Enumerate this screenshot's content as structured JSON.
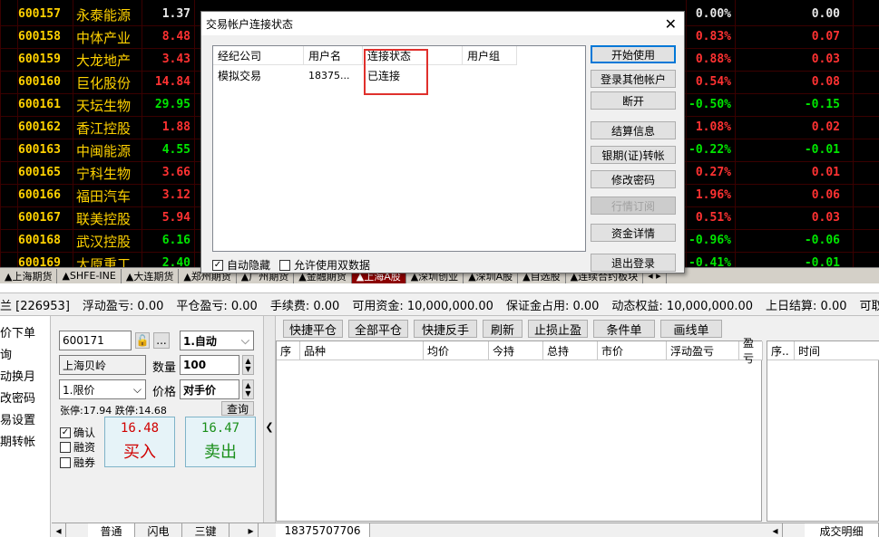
{
  "quotes": [
    {
      "code": "600157",
      "name": "永泰能源",
      "price": "1.37",
      "price_color": "white",
      "pct": "0.00%",
      "pct_color": "white",
      "chg": "0.00",
      "chg_color": "white"
    },
    {
      "code": "600158",
      "name": "中体产业",
      "price": "8.48",
      "price_color": "red",
      "pct": "0.83%",
      "pct_color": "red",
      "chg": "0.07",
      "chg_color": "red"
    },
    {
      "code": "600159",
      "name": "大龙地产",
      "price": "3.43",
      "price_color": "red",
      "pct": "0.88%",
      "pct_color": "red",
      "chg": "0.03",
      "chg_color": "red"
    },
    {
      "code": "600160",
      "name": "巨化股份",
      "price": "14.84",
      "price_color": "red",
      "pct": "0.54%",
      "pct_color": "red",
      "chg": "0.08",
      "chg_color": "red"
    },
    {
      "code": "600161",
      "name": "天坛生物",
      "price": "29.95",
      "price_color": "green",
      "pct": "-0.50%",
      "pct_color": "green",
      "chg": "-0.15",
      "chg_color": "green"
    },
    {
      "code": "600162",
      "name": "香江控股",
      "price": "1.88",
      "price_color": "red",
      "pct": "1.08%",
      "pct_color": "red",
      "chg": "0.02",
      "chg_color": "red"
    },
    {
      "code": "600163",
      "name": "中闽能源",
      "price": "4.55",
      "price_color": "green",
      "pct": "-0.22%",
      "pct_color": "green",
      "chg": "-0.01",
      "chg_color": "green"
    },
    {
      "code": "600165",
      "name": "宁科生物",
      "price": "3.66",
      "price_color": "red",
      "pct": "0.27%",
      "pct_color": "red",
      "chg": "0.01",
      "chg_color": "red"
    },
    {
      "code": "600166",
      "name": "福田汽车",
      "price": "3.12",
      "price_color": "red",
      "pct": "1.96%",
      "pct_color": "red",
      "chg": "0.06",
      "chg_color": "red"
    },
    {
      "code": "600167",
      "name": "联美控股",
      "price": "5.94",
      "price_color": "red",
      "pct": "0.51%",
      "pct_color": "red",
      "chg": "0.03",
      "chg_color": "red"
    },
    {
      "code": "600168",
      "name": "武汉控股",
      "price": "6.16",
      "price_color": "green",
      "pct": "-0.96%",
      "pct_color": "green",
      "chg": "-0.06",
      "chg_color": "green"
    },
    {
      "code": "600169",
      "name": "太原重工",
      "price": "2.40",
      "price_color": "green",
      "pct": "-0.41%",
      "pct_color": "green",
      "chg": "-0.01",
      "chg_color": "green"
    }
  ],
  "market_tabs": [
    {
      "label": "▲上海期货",
      "active": false
    },
    {
      "label": "▲SHFE-INE",
      "active": false
    },
    {
      "label": "▲大连期货",
      "active": false
    },
    {
      "label": "▲郑州期货",
      "active": false
    },
    {
      "label": "▲广州期货",
      "active": false
    },
    {
      "label": "▲金融期货",
      "active": false
    },
    {
      "label": "▲上海A股",
      "active": true
    },
    {
      "label": "▲深圳创业",
      "active": false
    },
    {
      "label": "▲深圳A股",
      "active": false
    },
    {
      "label": "▲自选股",
      "active": false
    },
    {
      "label": "▲连续合约板块",
      "active": false
    }
  ],
  "status_bar": {
    "account": "兰 [226953]",
    "float_pl": "浮动盈亏: 0.00",
    "close_pl": "平仓盈亏: 0.00",
    "fee": "手续费: 0.00",
    "avail": "可用资金: 10,000,000.00",
    "margin": "保证金占用: 0.00",
    "equity": "动态权益: 10,000,000.00",
    "settle": "上日结算: 0.00",
    "withdraw": "可取资金"
  },
  "left_menu": [
    "价下单",
    "询",
    "动换月",
    "改密码",
    "易设置",
    "期转帐"
  ],
  "order": {
    "code": "600171",
    "name": "上海贝岭",
    "mode": "1.自动",
    "qty_label": "数量",
    "qty": "100",
    "price_type": "1.限价",
    "price_label": "价格",
    "price": "对手价",
    "limits": "张停:17.94 跌停:14.68",
    "query_label": "查询",
    "more_label": "...",
    "confirm_label": "确认",
    "margin_buy_label": "融资",
    "margin_sell_label": "融券",
    "buy_price": "16.48",
    "buy_label": "买入",
    "sell_price": "16.47",
    "sell_label": "卖出"
  },
  "toolbar": [
    "快捷平仓",
    "全部平仓",
    "快捷反手",
    "刷新",
    "止损止盈",
    "条件单",
    "画线单"
  ],
  "position_headers": [
    "序",
    "品种",
    "均价",
    "今持",
    "总持",
    "市价",
    "浮动盈亏",
    "盈亏"
  ],
  "right_headers": [
    "序..",
    "时间"
  ],
  "bottom_tabs": {
    "normal": "普通",
    "flash": "闪电",
    "three": "三键",
    "account": "18375707706",
    "deal": "成交明细"
  },
  "dialog": {
    "title": "交易帐户连接状态",
    "headers": [
      "经纪公司",
      "用户名",
      "连接状态",
      "用户组"
    ],
    "row": {
      "broker": "模拟交易",
      "user": "18375...",
      "state": "已连接",
      "group": ""
    },
    "buttons": [
      "开始使用",
      "登录其他帐户",
      "断开",
      "结算信息",
      "银期(证)转帐",
      "修改密码",
      "行情订阅",
      "资金详情",
      "退出登录"
    ],
    "auto_hide_label": "自动隐藏",
    "dual_data_label": "允许使用双数据",
    "auto_hide": true,
    "dual_data": false
  },
  "colors": {
    "up": "#ff3232",
    "down": "#00e600",
    "flat": "#e8e8e8",
    "code": "#ffd200",
    "highlight": "#e0302c"
  }
}
